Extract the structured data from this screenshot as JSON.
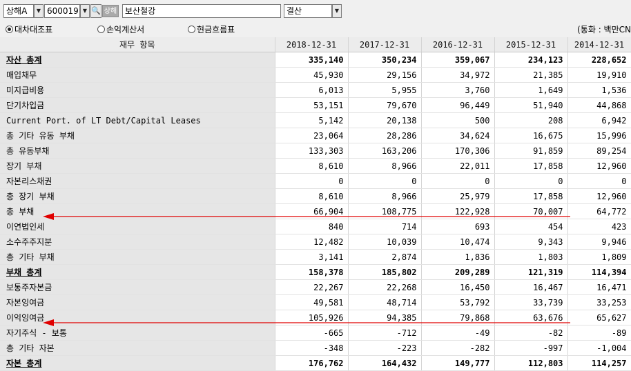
{
  "toolbar": {
    "exchange": "상해A",
    "code": "600019",
    "search_icon": "magnifier-icon",
    "group_button": "상해",
    "company": "보산철강",
    "period": "결산"
  },
  "tabs": [
    {
      "label": "대차대조표",
      "selected": true
    },
    {
      "label": "손익계산서",
      "selected": false
    },
    {
      "label": "현금흐름표",
      "selected": false
    }
  ],
  "currency_note": "(통화 : 백만CN",
  "table": {
    "headers": [
      "재무 항목",
      "2018-12-31",
      "2017-12-31",
      "2016-12-31",
      "2015-12-31",
      "2014-12-31"
    ],
    "rows": [
      {
        "name": "자산 총계",
        "bold": true,
        "values": [
          "335,140",
          "350,234",
          "359,067",
          "234,123",
          "228,652"
        ]
      },
      {
        "name": "매입채무",
        "values": [
          "45,930",
          "29,156",
          "34,972",
          "21,385",
          "19,910"
        ]
      },
      {
        "name": "미지급비용",
        "values": [
          "6,013",
          "5,955",
          "3,760",
          "1,649",
          "1,536"
        ]
      },
      {
        "name": "단기차입금",
        "values": [
          "53,151",
          "79,670",
          "96,449",
          "51,940",
          "44,868"
        ]
      },
      {
        "name": "Current Port. of LT Debt/Capital Leases",
        "values": [
          "5,142",
          "20,138",
          "500",
          "208",
          "6,942"
        ]
      },
      {
        "name": "총 기타 유동 부채",
        "values": [
          "23,064",
          "28,286",
          "34,624",
          "16,675",
          "15,996"
        ]
      },
      {
        "name": "총 유동부채",
        "values": [
          "133,303",
          "163,206",
          "170,306",
          "91,859",
          "89,254"
        ]
      },
      {
        "name": "장기 부채",
        "values": [
          "8,610",
          "8,966",
          "22,011",
          "17,858",
          "12,960"
        ]
      },
      {
        "name": "자본리스채권",
        "values": [
          "0",
          "0",
          "0",
          "0",
          "0"
        ]
      },
      {
        "name": "총 장기 부채",
        "values": [
          "8,610",
          "8,966",
          "25,979",
          "17,858",
          "12,960"
        ]
      },
      {
        "name": "총 부채",
        "values": [
          "66,904",
          "108,775",
          "122,928",
          "70,007",
          "64,772"
        ]
      },
      {
        "name": "이연법인세",
        "values": [
          "840",
          "714",
          "693",
          "454",
          "423"
        ]
      },
      {
        "name": "소수주주지분",
        "values": [
          "12,482",
          "10,039",
          "10,474",
          "9,343",
          "9,946"
        ]
      },
      {
        "name": "총 기타 부채",
        "values": [
          "3,141",
          "2,874",
          "1,836",
          "1,803",
          "1,809"
        ]
      },
      {
        "name": "부채 총계",
        "bold": true,
        "values": [
          "158,378",
          "185,802",
          "209,289",
          "121,319",
          "114,394"
        ]
      },
      {
        "name": "보통주자본금",
        "values": [
          "22,267",
          "22,268",
          "16,450",
          "16,467",
          "16,471"
        ]
      },
      {
        "name": "자본잉여금",
        "values": [
          "49,581",
          "48,714",
          "53,792",
          "33,739",
          "33,253"
        ]
      },
      {
        "name": "이익잉여금",
        "values": [
          "105,926",
          "94,385",
          "79,868",
          "63,676",
          "65,627"
        ]
      },
      {
        "name": "자기주식 - 보통",
        "values": [
          "-665",
          "-712",
          "-49",
          "-82",
          "-89"
        ]
      },
      {
        "name": "총 기타 자본",
        "values": [
          "-348",
          "-223",
          "-282",
          "-997",
          "-1,004"
        ]
      },
      {
        "name": "자본 총계",
        "bold": true,
        "values": [
          "176,762",
          "164,432",
          "149,777",
          "112,803",
          "114,257"
        ]
      }
    ]
  },
  "annotations": {
    "arrow_color": "#e00000",
    "arrow_rows": [
      "총 부채",
      "이익잉여금"
    ]
  }
}
